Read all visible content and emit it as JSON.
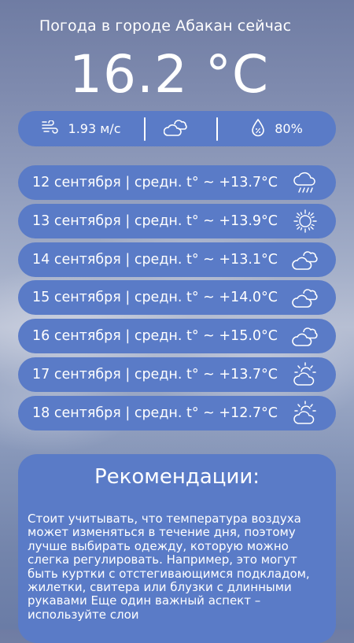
{
  "header": {
    "title": "Погода в городе Абакан сейчас",
    "temperature": "16.2 °C"
  },
  "current": {
    "wind": "1.93 м/с",
    "wind_icon": "wind-icon",
    "sky_icon": "partly-cloudy-icon",
    "humidity": "80%",
    "humidity_icon": "droplet-icon"
  },
  "forecast": [
    {
      "text": "12 сентября | средн. t° ~ +13.7°C",
      "icon": "rain-icon"
    },
    {
      "text": "13 сентября | средн. t° ~ +13.9°C",
      "icon": "sun-icon"
    },
    {
      "text": "14 сентября | средн. t° ~ +13.1°C",
      "icon": "clouds-icon"
    },
    {
      "text": "15 сентября | средн. t° ~ +14.0°C",
      "icon": "clouds-icon"
    },
    {
      "text": "16 сентября | средн. t° ~ +15.0°C",
      "icon": "clouds-icon"
    },
    {
      "text": "17 сентября | средн. t° ~ +13.7°C",
      "icon": "sun-behind-cloud-icon"
    },
    {
      "text": "18 сентября | средн. t° ~ +12.7°C",
      "icon": "sun-behind-cloud-icon"
    }
  ],
  "recommendations": {
    "title": "Рекомендации:",
    "text": "Стоит учитывать, что температура воздуха может изменяться в течение дня, поэтому лучше выбирать одежду, которую можно слегка регулировать. Например, это могут быть куртки с отстегивающимся подкладом, жилетки, свитера или блузки с длинными рукавами Еще один важный аспект – используйте слои"
  },
  "colors": {
    "card": "#5a7bc7",
    "text": "#ffffff"
  }
}
